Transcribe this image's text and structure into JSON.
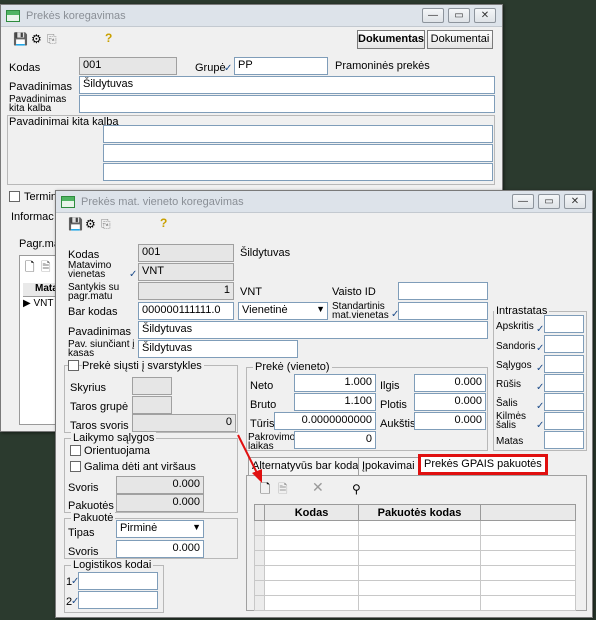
{
  "back_window": {
    "title": "Prekės koregavimas",
    "toolbar": {
      "dokumentas": "Dokumentas",
      "dokumentai": "Dokumentai"
    },
    "fields": {
      "kodas_label": "Kodas",
      "kodas_value": "001",
      "grupe_label": "Grupė",
      "grupe_value": "PP",
      "grupe_name": "Pramoninės prekės",
      "pav_label": "Pavadinimas",
      "pav_value": "Šildytuvas",
      "pav_kita_label": "Pavadinimas kita kalba",
      "pav_kitos_label": "Pavadinimai kita kalba",
      "terminal_label": "Termin",
      "info_label": "Informac",
      "pagr_label": "Pagr.ma",
      "grid_col": "Matav",
      "grid_row": "VNT"
    }
  },
  "front_window": {
    "title": "Prekės mat. vieneto koregavimas",
    "main": {
      "kodas_label": "Kodas",
      "kodas_value": "001",
      "kodas_name": "Šildytuvas",
      "matavimo_label": "Matavimo vienetas",
      "matavimo_value": "VNT",
      "santykis_label": "Santykis su pagr.matu",
      "santykis_value": "1",
      "santykis_unit": "VNT",
      "vaisto_label": "Vaisto ID",
      "bar_label": "Bar kodas",
      "bar_value": "000000111111.0",
      "bar_type": "Vienetinė",
      "standartinis_label": "Standartinis mat.vienetas",
      "pav_label": "Pavadinimas",
      "pav_value": "Šildytuvas",
      "pav_siunciant_label": "Pav. siunčiant į kasas",
      "pav_siunciant_value": "Šildytuvas"
    },
    "svarstykles": {
      "title": "Prekė siųsti į svarstykles",
      "skyrius": "Skyrius",
      "taros_grupe": "Taros grupė",
      "taros_svoris": "Taros svoris",
      "taros_svoris_value": "0"
    },
    "laikymo": {
      "title": "Laikymo sąlygos",
      "orientuojama": "Orientuojama",
      "galima": "Galima dėti ant viršaus",
      "svoris": "Svoris",
      "svoris_value": "0.000",
      "pakuotes": "Pakuotės",
      "pakuotes_value": "0.000"
    },
    "pakuote": {
      "title": "Pakuotė",
      "tipas": "Tipas",
      "tipas_value": "Pirminė",
      "svoris": "Svoris",
      "svoris_value": "0.000"
    },
    "logistikos": {
      "title": "Logistikos kodai",
      "row1": "1",
      "row2": "2"
    },
    "preke_vieneto": {
      "title": "Prekė (vieneto)",
      "neto": "Neto",
      "neto_value": "1.000",
      "bruto": "Bruto",
      "bruto_value": "1.100",
      "turis": "Tūris",
      "turis_value": "0.0000000000",
      "pakrovimo": "Pakrovimo laikas",
      "pakrovimo_value": "0",
      "ilgis": "Ilgis",
      "ilgis_value": "0.000",
      "plotis": "Plotis",
      "plotis_value": "0.000",
      "auksis": "Aukštis",
      "auksis_value": "0.000"
    },
    "intrastatas": {
      "title": "Intrastatas",
      "items": [
        "Apskritis",
        "Sandoris",
        "Sąlygos",
        "Rūšis",
        "Šalis",
        "Kilmės šalis",
        "Matas"
      ]
    },
    "tabs": [
      "Alternatyvūs bar kodai",
      "Įpokavimai",
      "Prekės GPAIS pakuotės"
    ],
    "grid": {
      "col1": "Kodas",
      "col2": "Pakuotės kodas"
    },
    "highlight_color": "#e01010"
  }
}
